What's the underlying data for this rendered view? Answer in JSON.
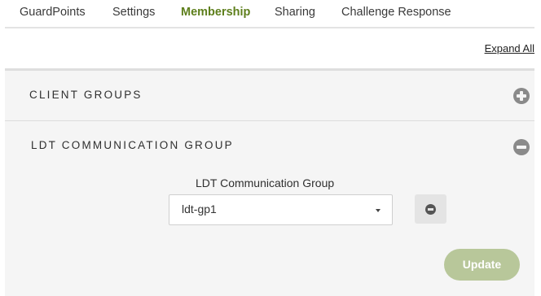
{
  "tabs": [
    {
      "label": "GuardPoints"
    },
    {
      "label": "Settings"
    },
    {
      "label": "Membership",
      "active": true
    },
    {
      "label": "Sharing"
    },
    {
      "label": "Challenge Response"
    }
  ],
  "expand_all_label": "Expand All",
  "sections": {
    "client_groups": {
      "title": "CLIENT GROUPS",
      "state": "collapsed",
      "icon": "plus-circle-icon"
    },
    "ldt_group": {
      "title": "LDT COMMUNICATION GROUP",
      "state": "expanded",
      "icon": "minus-circle-icon",
      "field_label": "LDT Communication Group",
      "selected_value": "ldt-gp1",
      "remove_icon": "remove-circle-icon",
      "update_label": "Update"
    }
  },
  "colors": {
    "accent": "#6d8b2a",
    "update_button": "#b8c79a",
    "panel_bg": "#f5f5f5"
  }
}
